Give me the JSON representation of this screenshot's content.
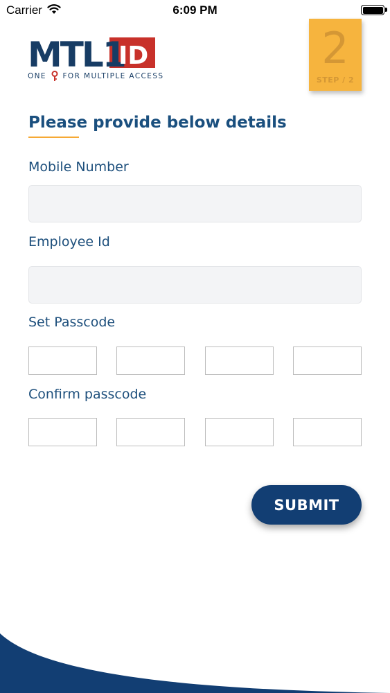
{
  "status_bar": {
    "carrier": "Carrier",
    "time": "6:09 PM",
    "battery_level": 1.0
  },
  "logo": {
    "text_mtl": "MTL",
    "text_one": "1",
    "text_id": "ID",
    "tagline_left": "ONE",
    "tagline_right": "FOR MULTIPLE ACCESS",
    "colors": {
      "navy": "#173c64",
      "red": "#c8312a"
    }
  },
  "step_badge": {
    "number": "2",
    "label": "STEP / 2",
    "color": "#f6b43e"
  },
  "form": {
    "title": "Please provide below details",
    "mobile": {
      "label": "Mobile Number",
      "value": "",
      "placeholder": ""
    },
    "employee": {
      "label": "Employee Id",
      "value": "",
      "placeholder": ""
    },
    "set_passcode": {
      "label": "Set Passcode",
      "digits": [
        "",
        "",
        "",
        ""
      ]
    },
    "confirm_passcode": {
      "label": "Confirm passcode",
      "digits": [
        "",
        "",
        "",
        ""
      ]
    },
    "submit_label": "SUBMIT"
  },
  "colors": {
    "accent": "#1a4f7e",
    "button": "#123e73",
    "underline": "#f6a935",
    "wave": "#123e73"
  },
  "icons": [
    "wifi-icon",
    "battery-icon",
    "key-icon"
  ]
}
